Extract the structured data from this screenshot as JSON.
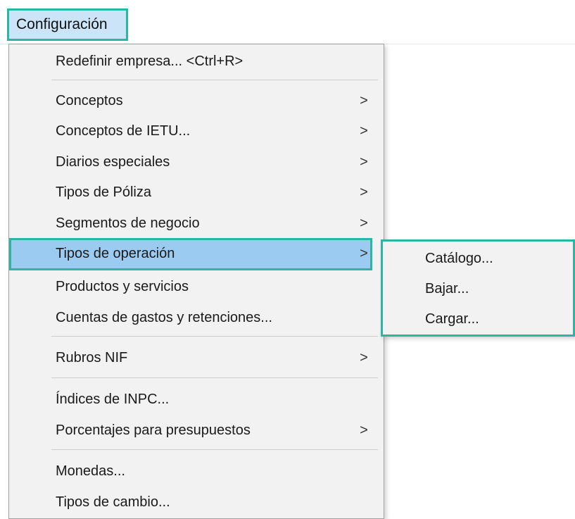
{
  "menubar": {
    "configuracion": "Configuración"
  },
  "menu": {
    "redefinir": "Redefinir empresa... <Ctrl+R>",
    "conceptos": "Conceptos",
    "conceptos_ietu": "Conceptos de IETU...",
    "diarios": "Diarios especiales",
    "tipos_poliza": "Tipos de Póliza",
    "segmentos": "Segmentos de negocio",
    "tipos_operacion": "Tipos de operación",
    "productos": "Productos y servicios",
    "cuentas": "Cuentas de gastos y retenciones...",
    "rubros": "Rubros NIF",
    "indices": "Índices de INPC...",
    "porcentajes": "Porcentajes para presupuestos",
    "monedas": "Monedas...",
    "tipos_cambio": "Tipos de cambio..."
  },
  "submenu": {
    "catalogo": "Catálogo...",
    "bajar": "Bajar...",
    "cargar": "Cargar..."
  },
  "icons": {
    "submenu_arrow": "chevron-right-icon",
    "arrow_glyph": ">"
  },
  "colors": {
    "highlight": "#9ccbf2",
    "outline": "#2bb5a5",
    "menu_bg": "#f2f2f2",
    "menubar_active": "#cce4f7"
  }
}
